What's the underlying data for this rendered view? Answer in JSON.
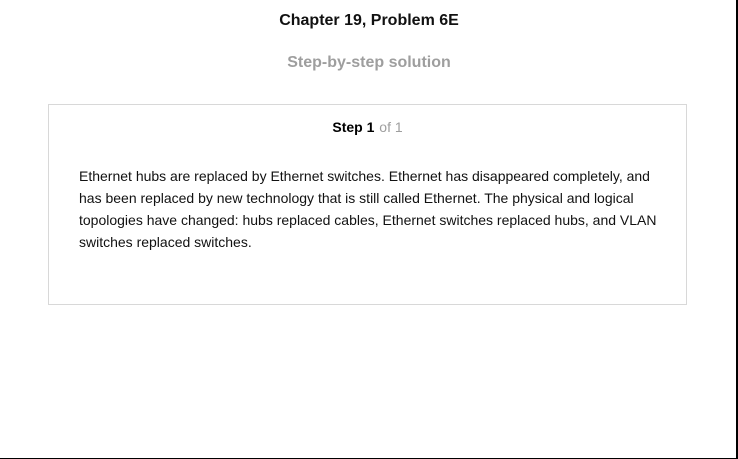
{
  "header": {
    "title": "Chapter 19, Problem 6E",
    "subtitle": "Step-by-step solution"
  },
  "step": {
    "label": "Step",
    "number": "1",
    "of_text": "of 1",
    "body": "Ethernet hubs are replaced by Ethernet switches. Ethernet has disappeared completely, and has been replaced by new technology that is still called Ethernet. The physical and logical topologies have changed: hubs replaced cables, Ethernet switches replaced hubs, and VLAN switches replaced switches."
  }
}
